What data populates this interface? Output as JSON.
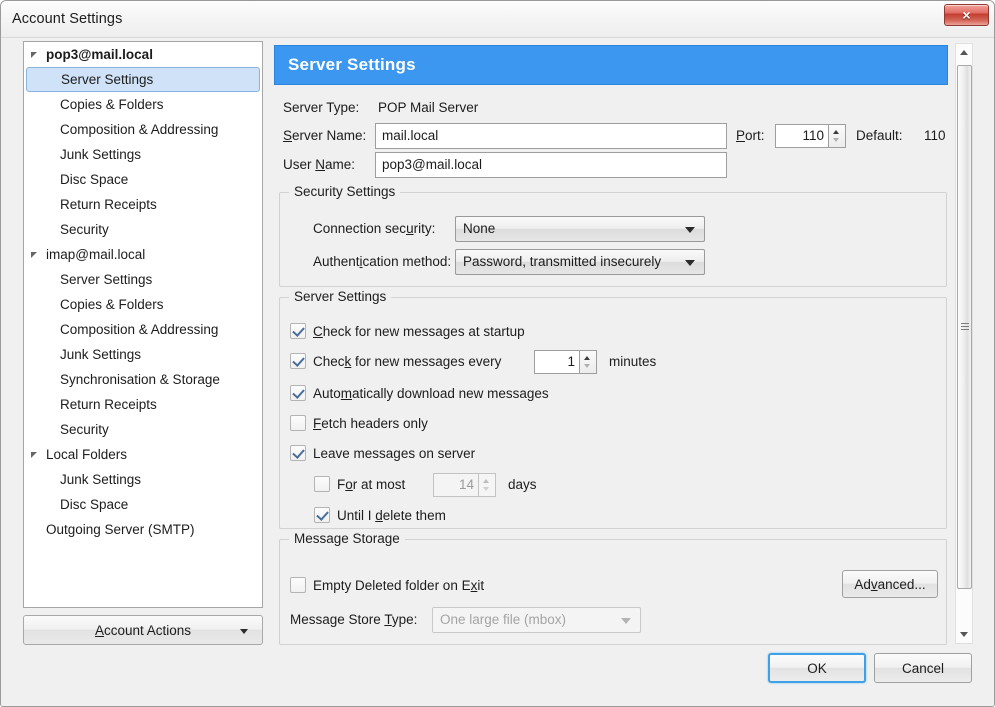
{
  "window": {
    "title": "Account Settings",
    "close_label": "×"
  },
  "sidebar": {
    "items": [
      {
        "label": "pop3@mail.local",
        "level": "account",
        "bold": true,
        "selected": false,
        "twisty": true
      },
      {
        "label": "Server Settings",
        "level": "child",
        "bold": false,
        "selected": true,
        "twisty": false
      },
      {
        "label": "Copies & Folders",
        "level": "child",
        "bold": false,
        "selected": false,
        "twisty": false
      },
      {
        "label": "Composition & Addressing",
        "level": "child",
        "bold": false,
        "selected": false,
        "twisty": false
      },
      {
        "label": "Junk Settings",
        "level": "child",
        "bold": false,
        "selected": false,
        "twisty": false
      },
      {
        "label": "Disc Space",
        "level": "child",
        "bold": false,
        "selected": false,
        "twisty": false
      },
      {
        "label": "Return Receipts",
        "level": "child",
        "bold": false,
        "selected": false,
        "twisty": false
      },
      {
        "label": "Security",
        "level": "child",
        "bold": false,
        "selected": false,
        "twisty": false
      },
      {
        "label": "imap@mail.local",
        "level": "account",
        "bold": false,
        "selected": false,
        "twisty": true
      },
      {
        "label": "Server Settings",
        "level": "child",
        "bold": false,
        "selected": false,
        "twisty": false
      },
      {
        "label": "Copies & Folders",
        "level": "child",
        "bold": false,
        "selected": false,
        "twisty": false
      },
      {
        "label": "Composition & Addressing",
        "level": "child",
        "bold": false,
        "selected": false,
        "twisty": false
      },
      {
        "label": "Junk Settings",
        "level": "child",
        "bold": false,
        "selected": false,
        "twisty": false
      },
      {
        "label": "Synchronisation & Storage",
        "level": "child",
        "bold": false,
        "selected": false,
        "twisty": false
      },
      {
        "label": "Return Receipts",
        "level": "child",
        "bold": false,
        "selected": false,
        "twisty": false
      },
      {
        "label": "Security",
        "level": "child",
        "bold": false,
        "selected": false,
        "twisty": false
      },
      {
        "label": "Local Folders",
        "level": "account",
        "bold": false,
        "selected": false,
        "twisty": true
      },
      {
        "label": "Junk Settings",
        "level": "child",
        "bold": false,
        "selected": false,
        "twisty": false
      },
      {
        "label": "Disc Space",
        "level": "child",
        "bold": false,
        "selected": false,
        "twisty": false
      },
      {
        "label": "Outgoing Server (SMTP)",
        "level": "account",
        "bold": false,
        "selected": false,
        "twisty": false
      }
    ],
    "account_actions": {
      "accel": "A",
      "rest": "ccount Actions"
    }
  },
  "panel": {
    "header_title": "Server Settings",
    "server_type_label": "Server Type:",
    "server_type_value": "POP Mail Server",
    "server_name_accel_pre": "",
    "server_name_accel": "S",
    "server_name_rest": "erver Name:",
    "server_name_value": "mail.local",
    "port_accel": "P",
    "port_rest": "ort:",
    "port_value": "110",
    "default_label": "Default:",
    "default_value": "110",
    "user_name_pre": "User ",
    "user_name_accel": "N",
    "user_name_rest": "ame:",
    "user_name_value": "pop3@mail.local"
  },
  "security_settings": {
    "group_title": "Security Settings",
    "connection_security": {
      "label_pre": "Connection sec",
      "label_accel": "u",
      "label_post": "rity:",
      "value": "None"
    },
    "authentication_method": {
      "label_pre": "Authent",
      "label_accel": "i",
      "label_post": "cation method:",
      "value": "Password, transmitted insecurely"
    }
  },
  "server_settings_group": {
    "group_title": "Server Settings",
    "check_startup": {
      "pre": "",
      "accel": "C",
      "post": "heck for new messages at startup",
      "checked": true
    },
    "check_every": {
      "pre": "Chec",
      "accel": "k",
      "post": " for new messages every",
      "checked": true,
      "value": "1",
      "unit": "minutes"
    },
    "auto_download": {
      "pre": "Auto",
      "accel": "m",
      "post": "atically download new messages",
      "checked": true
    },
    "fetch_headers": {
      "pre": "",
      "accel": "F",
      "post": "etch headers only",
      "checked": false
    },
    "leave_on_server": {
      "pre": "Leave messa",
      "accel": "g",
      "post": "es on server",
      "checked": true
    },
    "for_at_most": {
      "pre": "F",
      "accel": "o",
      "post": "r at most",
      "checked": false,
      "value": "14",
      "unit": "days",
      "disabled": true
    },
    "until_delete": {
      "pre": "Until I ",
      "accel": "d",
      "post": "elete them",
      "checked": true
    }
  },
  "message_storage": {
    "group_title": "Message Storage",
    "empty_deleted": {
      "pre": "Empty Deleted folder on E",
      "accel": "x",
      "post": "it",
      "checked": false
    },
    "store_type": {
      "label_pre": "Message Store ",
      "label_accel": "T",
      "label_post": "ype:",
      "value": "One large file (mbox)",
      "disabled": true
    },
    "advanced_button": {
      "pre": "Ad",
      "accel": "v",
      "post": "anced..."
    }
  },
  "dialog_buttons": {
    "ok": "OK",
    "cancel": "Cancel"
  },
  "colors": {
    "header_blue": "#3b97f0",
    "selection_blue": "#cfe2f7",
    "close_red": "#c33c2e",
    "check_blue": "#4a6d9c"
  }
}
